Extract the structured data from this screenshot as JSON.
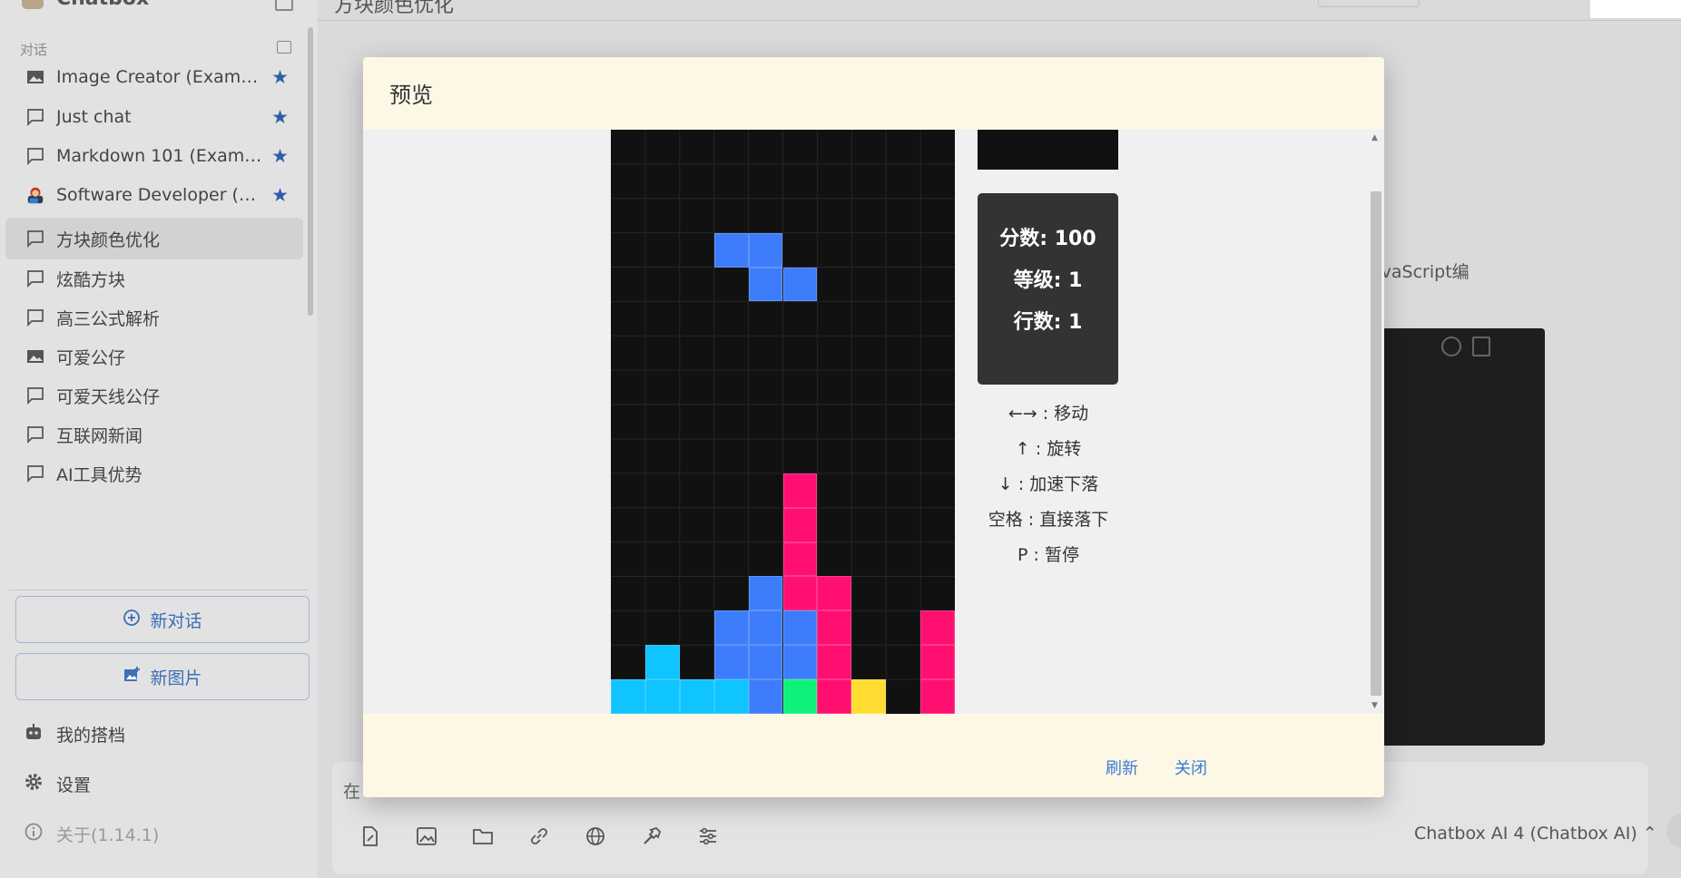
{
  "app": {
    "title": "Chatbox"
  },
  "sidebar": {
    "section_label": "对话",
    "conversations": [
      {
        "label": "Image Creator (Example)",
        "icon": "image-icon",
        "starred": true
      },
      {
        "label": "Just chat",
        "icon": "chat-bubble-icon",
        "starred": true
      },
      {
        "label": "Markdown 101 (Exampl...",
        "icon": "chat-bubble-icon",
        "starred": true
      },
      {
        "label": "Software Developer (Ex...",
        "icon": "avatar-icon",
        "starred": true
      },
      {
        "label": "方块颜色优化",
        "icon": "chat-bubble-icon",
        "starred": false,
        "active": true
      },
      {
        "label": "炫酷方块",
        "icon": "chat-bubble-icon",
        "starred": false
      },
      {
        "label": "高三公式解析",
        "icon": "chat-bubble-icon",
        "starred": false
      },
      {
        "label": "可爱公仔",
        "icon": "image-icon",
        "starred": false
      },
      {
        "label": "可爱天线公仔",
        "icon": "chat-bubble-icon",
        "starred": false
      },
      {
        "label": "互联网新闻",
        "icon": "chat-bubble-icon",
        "starred": false
      },
      {
        "label": "AI工具优势",
        "icon": "chat-bubble-icon",
        "starred": false
      }
    ],
    "new_chat_label": "新对话",
    "new_image_label": "新图片",
    "my_partners_label": "我的搭档",
    "settings_label": "设置",
    "about_label": "关于(1.14.1)"
  },
  "main": {
    "partial_text": "avaScript编",
    "input_placeholder": "在",
    "model_label": "Chatbox AI 4 (Chatbox AI) ⌃"
  },
  "modal": {
    "title": "预览",
    "refresh_label": "刷新",
    "close_label": "关闭",
    "stats": {
      "score": "分数: 100",
      "level": "等级: 1",
      "lines": "行数: 1"
    },
    "controls": [
      "←→ : 移动",
      "↑ : 旋转",
      "↓ : 加速下落",
      "空格 : 直接落下",
      "P : 暂停"
    ]
  },
  "game": {
    "cols": 10,
    "rows": 17,
    "colors": {
      "B": "#3d7dfb",
      "P": "#ff1070",
      "C": "#0fc4ff",
      "G": "#0ef27a",
      "Y": "#ffdd33"
    },
    "falling_piece": [
      [
        3,
        3,
        "B"
      ],
      [
        4,
        3,
        "B"
      ],
      [
        4,
        4,
        "B"
      ],
      [
        5,
        4,
        "B"
      ]
    ],
    "locked_cells": [
      [
        5,
        10,
        "P"
      ],
      [
        5,
        11,
        "P"
      ],
      [
        5,
        12,
        "P"
      ],
      [
        5,
        13,
        "P"
      ],
      [
        4,
        13,
        "B"
      ],
      [
        6,
        13,
        "P"
      ],
      [
        3,
        14,
        "B"
      ],
      [
        4,
        14,
        "B"
      ],
      [
        5,
        14,
        "B"
      ],
      [
        6,
        14,
        "P"
      ],
      [
        9,
        14,
        "P"
      ],
      [
        1,
        15,
        "C"
      ],
      [
        3,
        15,
        "B"
      ],
      [
        4,
        15,
        "B"
      ],
      [
        5,
        15,
        "B"
      ],
      [
        6,
        15,
        "P"
      ],
      [
        9,
        15,
        "P"
      ],
      [
        0,
        16,
        "C"
      ],
      [
        1,
        16,
        "C"
      ],
      [
        2,
        16,
        "C"
      ],
      [
        3,
        16,
        "C"
      ],
      [
        4,
        16,
        "B"
      ],
      [
        5,
        16,
        "G"
      ],
      [
        6,
        16,
        "P"
      ],
      [
        7,
        16,
        "Y"
      ],
      [
        9,
        16,
        "P"
      ]
    ]
  }
}
